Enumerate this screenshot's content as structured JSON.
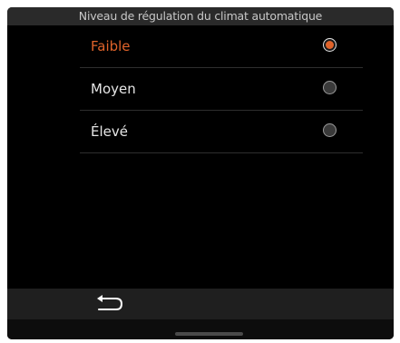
{
  "header": {
    "title": "Niveau de régulation du climat automatique"
  },
  "options": [
    {
      "label": "Faible",
      "selected": true
    },
    {
      "label": "Moyen",
      "selected": false
    },
    {
      "label": "Élevé",
      "selected": false
    }
  ],
  "footer": {
    "back_icon": "back-arrow-icon"
  },
  "colors": {
    "accent": "#e0632a",
    "background": "#000000",
    "title_bar": "#2a2a2a",
    "bottom_bar": "#1f1f1f"
  }
}
